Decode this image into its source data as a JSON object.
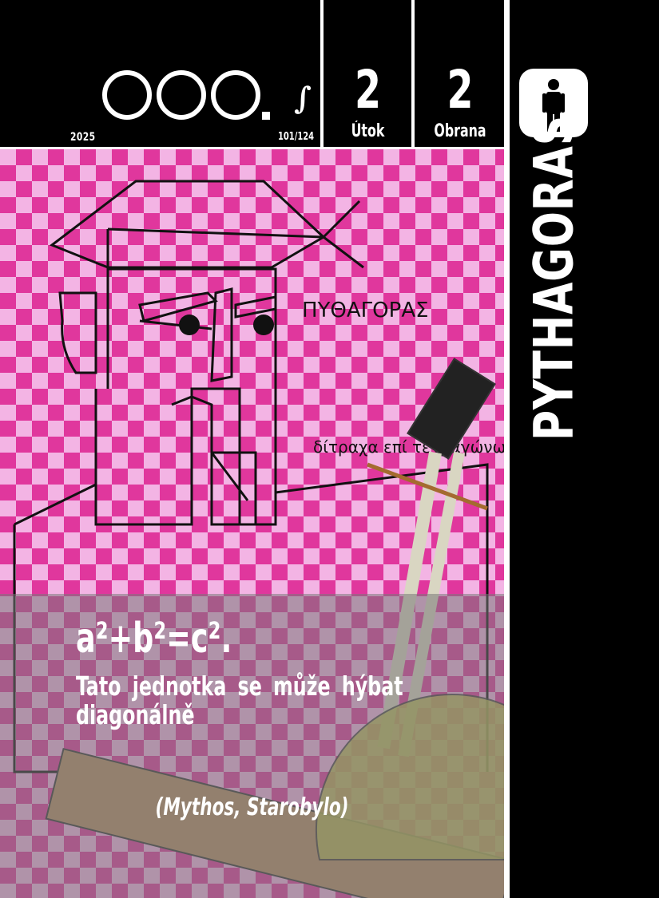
{
  "card": {
    "year": "2025",
    "number": "101/124",
    "cost_symbol": "∫",
    "attack": {
      "value": "2",
      "label": "Útok"
    },
    "defense": {
      "value": "2",
      "label": "Obrana"
    },
    "name": "PYTHAGORAS",
    "type_icon": "person-icon",
    "formula": "a²+b²=c².",
    "ability": "Tato jednotka se může hýbat diagonálně",
    "flavor": "(Mythos, Starobylo)",
    "sketch_labels": [
      "ΠΥΘΑΓΟΡΑΣ",
      "δίτραχα επί τετραγώνω"
    ],
    "colors": {
      "accent": "#e0379d",
      "background": "#000000",
      "pink_light": "#f3b4e4"
    }
  }
}
